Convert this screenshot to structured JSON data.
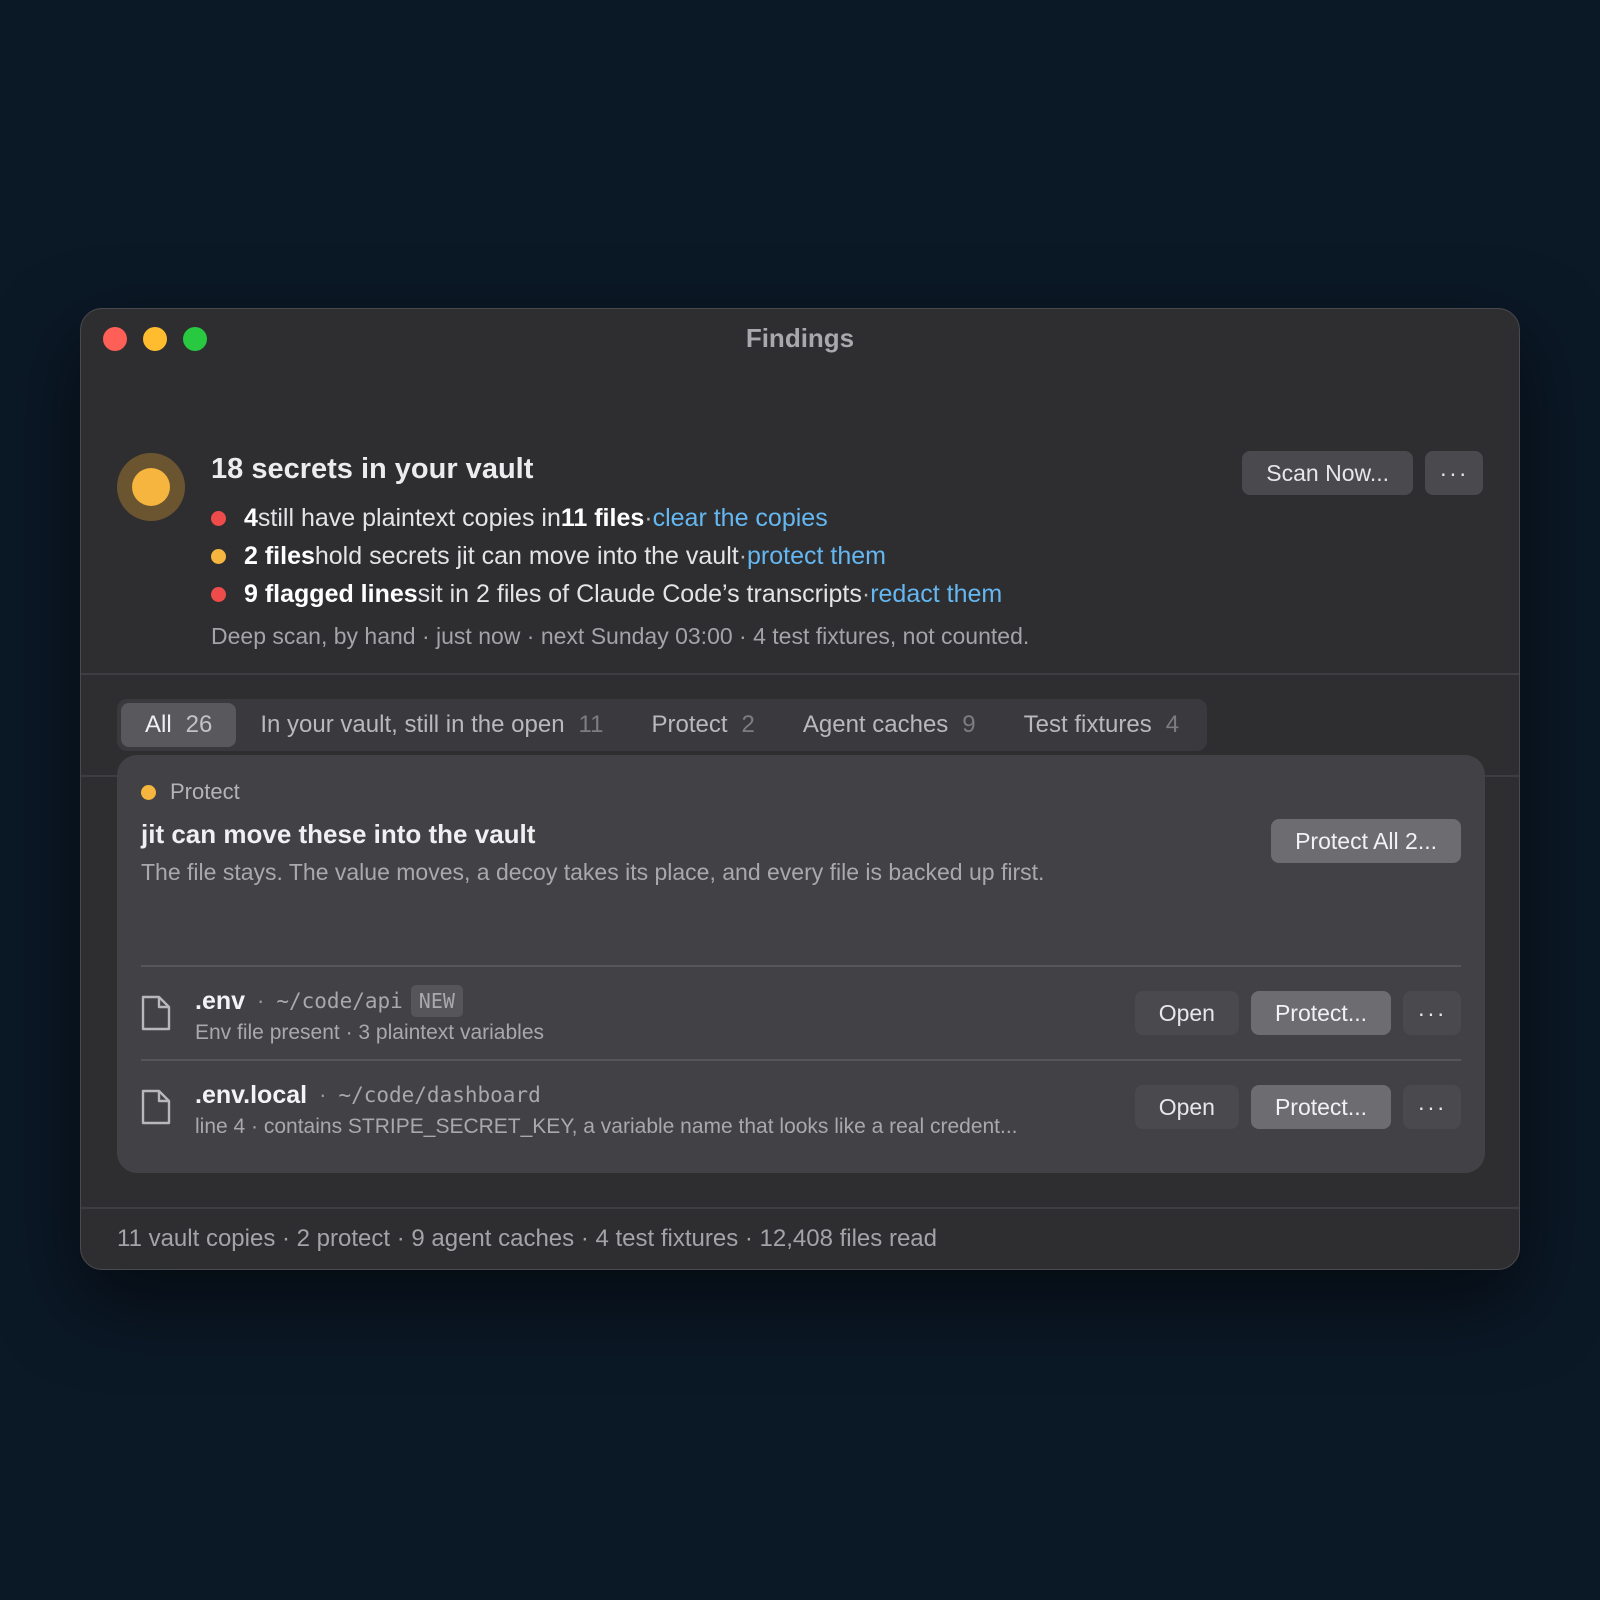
{
  "window": {
    "title": "Findings"
  },
  "summary": {
    "status_icon": "warning-amber-dot",
    "headline": "18 secrets in your vault",
    "bullets": [
      {
        "color": "#ee4b4b",
        "count": "4",
        "text1": " still have plaintext copies in ",
        "strong2": "11 files",
        "sep": " · ",
        "link": "clear the copies"
      },
      {
        "color": "#f5b53e",
        "count": "2 files",
        "text1": " hold secrets jit can move into the vault",
        "strong2": "",
        "sep": " · ",
        "link": "protect them"
      },
      {
        "color": "#ee4b4b",
        "count": "9 flagged lines",
        "text1": " sit in 2 files of Claude Code’s transcripts",
        "strong2": "",
        "sep": " · ",
        "link": "redact them"
      }
    ],
    "meta": "Deep scan, by hand · just now · next Sunday 03:00 · 4 test fixtures, not counted.",
    "scan_button": "Scan Now...",
    "more_button": "···"
  },
  "filters": [
    {
      "label": "All",
      "count": "26",
      "active": true
    },
    {
      "label": "In your vault, still in the open",
      "count": "11",
      "active": false
    },
    {
      "label": "Protect",
      "count": "2",
      "active": false
    },
    {
      "label": "Agent caches",
      "count": "9",
      "active": false
    },
    {
      "label": "Test fixtures",
      "count": "4",
      "active": false
    }
  ],
  "card": {
    "tag": "Protect",
    "tag_color": "#f5b53e",
    "title": "jit can move these into the vault",
    "description": "The file stays. The value moves, a decoy takes its place, and every file is backed up first.",
    "protect_all_button": "Protect All 2...",
    "rows": [
      {
        "icon": "document-icon",
        "name": ".env",
        "sep": "·",
        "path": "~/code/api",
        "badge": "NEW",
        "subtitle": "Env file present · 3 plaintext variables",
        "open_button": "Open",
        "protect_button": "Protect...",
        "more_button": "···"
      },
      {
        "icon": "document-icon",
        "name": ".env.local",
        "sep": "·",
        "path": "~/code/dashboard",
        "badge": "",
        "subtitle": "line 4 · contains STRIPE_SECRET_KEY, a variable name that looks like a real credent...",
        "open_button": "Open",
        "protect_button": "Protect...",
        "more_button": "···"
      }
    ]
  },
  "footer": {
    "text": "11 vault copies · 2 protect · 9 agent caches · 4 test fixtures · 12,408 files read"
  }
}
